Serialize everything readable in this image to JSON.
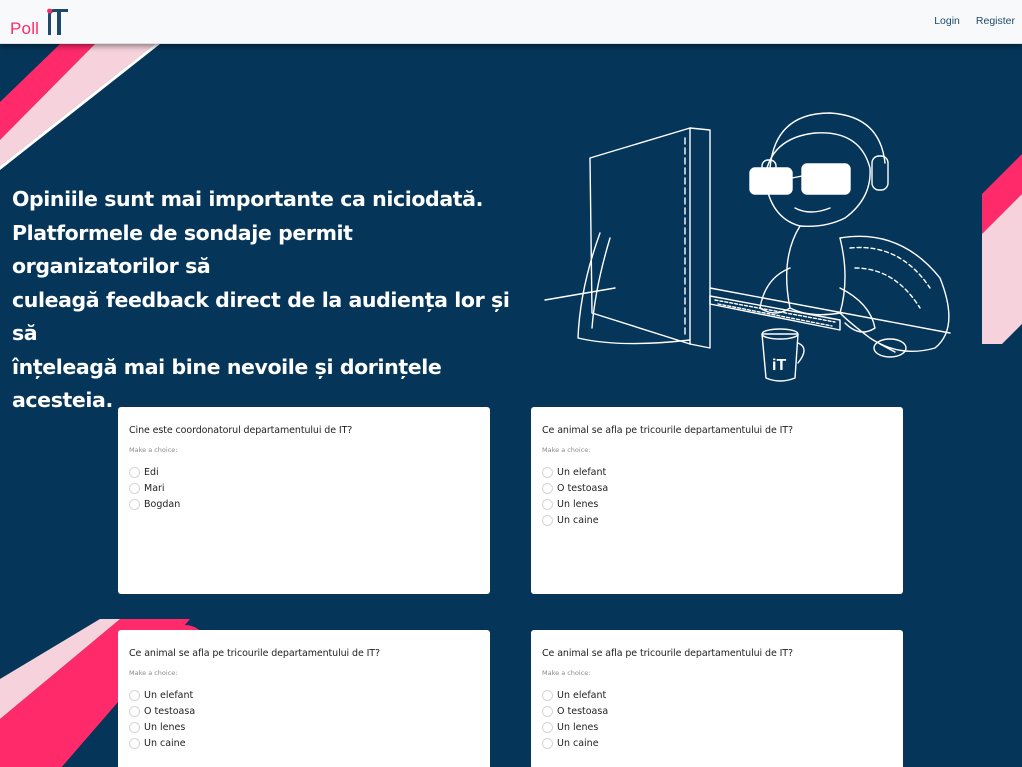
{
  "brand": {
    "logo_text": "Poll",
    "logo_mark": "IT"
  },
  "nav": {
    "login_label": "Login",
    "register_label": "Register"
  },
  "hero": {
    "line1": "Opiniile sunt mai importante ca niciodată.",
    "line2": "Platformele de sondaje permit organizatorilor să",
    "line3": "culeagă feedback direct de la audiența lor și să",
    "line4": "înțeleagă mai bine nevoile și dorințele acesteia."
  },
  "polls": [
    {
      "question": "Cine este coordonatorul departamentului de IT?",
      "hint": "Make a choice:",
      "options": [
        "Edi",
        "Mari",
        "Bogdan"
      ]
    },
    {
      "question": "Ce animal se afla pe tricourile departamentului de IT?",
      "hint": "Make a choice:",
      "options": [
        "Un elefant",
        "O testoasa",
        "Un lenes",
        "Un caine"
      ]
    },
    {
      "question": "Ce animal se afla pe tricourile departamentului de IT?",
      "hint": "Make a choice:",
      "options": [
        "Un elefant",
        "O testoasa",
        "Un lenes",
        "Un caine"
      ]
    },
    {
      "question": "Ce animal se afla pe tricourile departamentului de IT?",
      "hint": "Make a choice:",
      "options": [
        "Un elefant",
        "O testoasa",
        "Un lenes",
        "Un caine"
      ]
    }
  ],
  "colors": {
    "navy": "#053559",
    "pink": "#ff2a6a",
    "light_pink": "#f6d3dc",
    "white": "#ffffff"
  }
}
